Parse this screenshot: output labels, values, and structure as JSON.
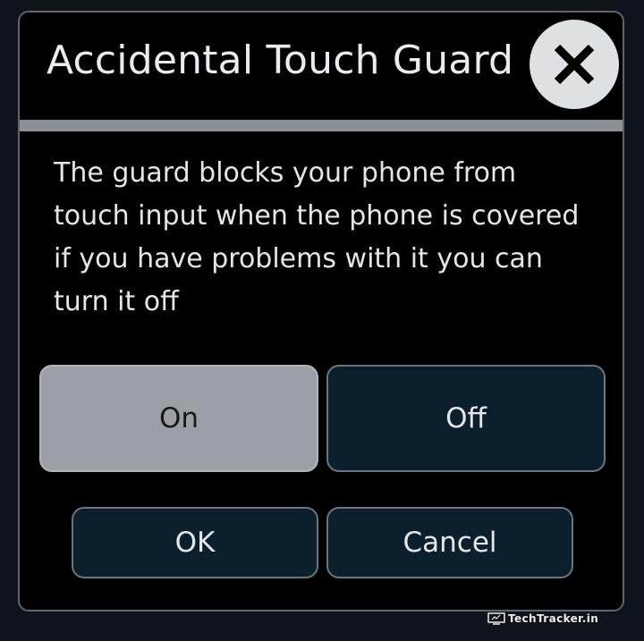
{
  "dialog": {
    "title": "Accidental Touch Guard",
    "message": "The guard blocks your phone from touch input when the phone is covered if you have problems with it you can turn it off",
    "close_icon": "close-icon",
    "toggle": {
      "on_label": "On",
      "off_label": "Off",
      "selected": "On"
    },
    "actions": {
      "ok_label": "OK",
      "cancel_label": "Cancel"
    }
  },
  "watermark": {
    "text": "TechTracker.in"
  },
  "colors": {
    "background": "#0f141a",
    "dialog_bg": "#000000",
    "divider": "#8a9094",
    "selected_button": "#9aa0a6",
    "button_bg": "#0c1f2d",
    "text": "#e3e6e8"
  }
}
